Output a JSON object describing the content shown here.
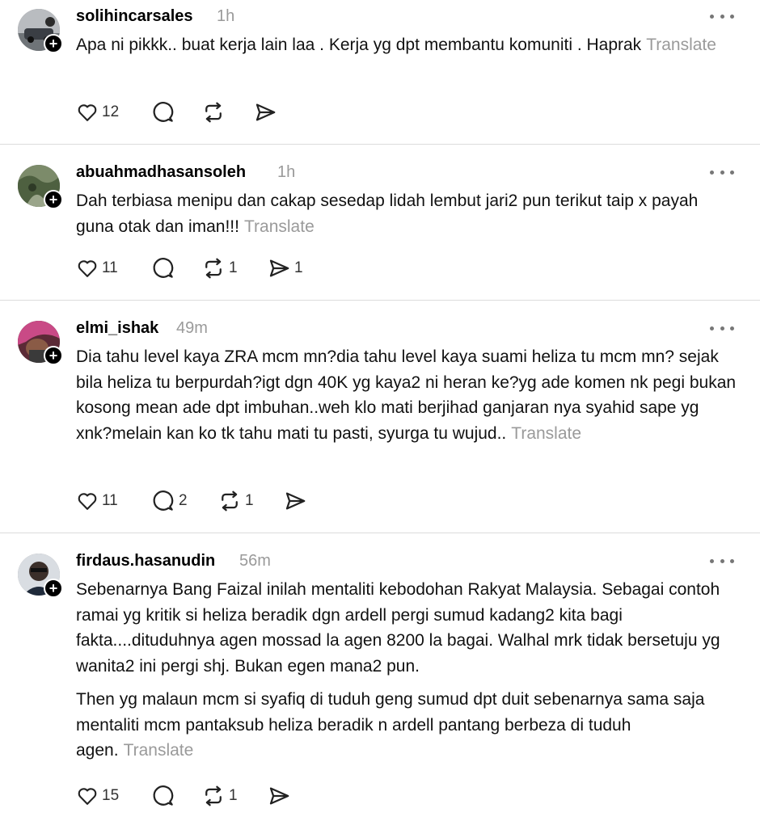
{
  "posts": [
    {
      "username": "solihincarsales",
      "time": "1h",
      "paragraphs": [
        "Apa ni pikkk.. buat kerja lain laa . Kerja yg dpt membantu komuniti . Haprak"
      ],
      "translate": "Translate",
      "likes": "12",
      "replies": "",
      "reposts": "",
      "shares": ""
    },
    {
      "username": "abuahmadhasansoleh",
      "time": "1h",
      "paragraphs": [
        "Dah terbiasa menipu dan cakap sesedap lidah lembut jari2 pun terikut taip x payah guna otak dan iman!!!"
      ],
      "translate": "Translate",
      "likes": "11",
      "replies": "",
      "reposts": "1",
      "shares": "1"
    },
    {
      "username": "elmi_ishak",
      "time": "49m",
      "paragraphs": [
        "Dia tahu level kaya ZRA mcm mn?dia tahu level kaya suami heliza tu mcm mn? sejak bila heliza tu berpurdah?igt dgn 40K yg kaya2 ni heran ke?yg ade komen nk pegi bukan kosong mean ade dpt imbuhan..weh klo mati berjihad ganjaran nya syahid sape yg xnk?melain kan ko tk tahu mati tu pasti, syurga tu wujud.."
      ],
      "translate": "Translate",
      "likes": "11",
      "replies": "2",
      "reposts": "1",
      "shares": ""
    },
    {
      "username": "firdaus.hasanudin",
      "time": "56m",
      "paragraphs": [
        "Sebenarnya Bang Faizal inilah mentaliti kebodohan Rakyat Malaysia. Sebagai contoh ramai yg kritik si heliza beradik dgn ardell pergi sumud kadang2 kita bagi fakta....dituduhnya agen mossad la agen 8200 la bagai. Walhal mrk tidak bersetuju yg wanita2 ini pergi shj. Bukan egen mana2 pun.",
        "Then yg malaun mcm si syafiq di tuduh geng sumud dpt duit sebenarnya sama saja mentaliti mcm pantaksub heliza beradik n ardell pantang berbeza di tuduh agen."
      ],
      "translate": "Translate",
      "likes": "15",
      "replies": "",
      "reposts": "1",
      "shares": ""
    }
  ]
}
